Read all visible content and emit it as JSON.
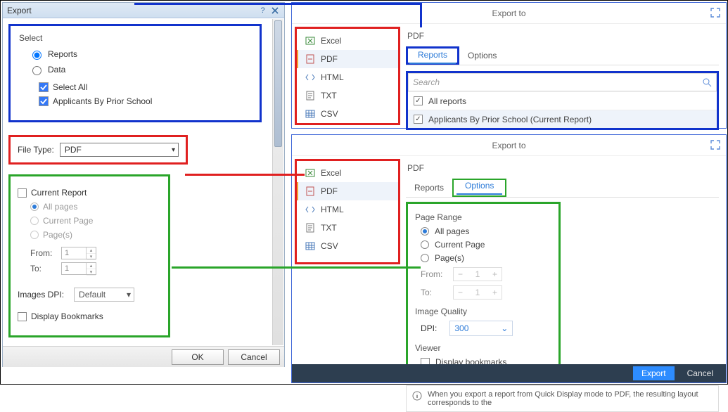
{
  "legacy": {
    "title": "Export",
    "select_label": "Select",
    "radios": {
      "reports": "Reports",
      "data": "Data",
      "selected": "reports"
    },
    "check_all": "Select All",
    "check_item": "Applicants By Prior School",
    "file_type_label": "File Type:",
    "file_type_value": "PDF",
    "opt": {
      "current_report": "Current Report",
      "all_pages": "All pages",
      "current_page": "Current Page",
      "pages": "Page(s)",
      "from": "From:",
      "to": "To:",
      "from_val": "1",
      "to_val": "1",
      "images_dpi": "Images DPI:",
      "dpi_value": "Default",
      "display_bookmarks": "Display Bookmarks"
    },
    "buttons": {
      "ok": "OK",
      "cancel": "Cancel"
    }
  },
  "modern_a": {
    "title": "Export to",
    "formats": [
      "Excel",
      "PDF",
      "HTML",
      "TXT",
      "CSV"
    ],
    "selected_format": "PDF",
    "head": "PDF",
    "tabs": {
      "reports": "Reports",
      "options": "Options",
      "active": "reports"
    },
    "search_placeholder": "Search",
    "reports": {
      "all": "All reports",
      "item": "Applicants By Prior School (Current Report)"
    }
  },
  "modern_b": {
    "title": "Export to",
    "formats": [
      "Excel",
      "PDF",
      "HTML",
      "TXT",
      "CSV"
    ],
    "selected_format": "PDF",
    "head": "PDF",
    "tabs": {
      "reports": "Reports",
      "options": "Options",
      "active": "options"
    },
    "page_range": {
      "title": "Page Range",
      "all": "All pages",
      "current": "Current Page",
      "pages": "Page(s)",
      "from": "From:",
      "to": "To:",
      "from_val": "1",
      "to_val": "1"
    },
    "image_quality": {
      "title": "Image Quality",
      "dpi_label": "DPI:",
      "dpi_value": "300"
    },
    "viewer": {
      "title": "Viewer",
      "display_bookmarks": "Display bookmarks"
    },
    "info": "When you export a report from Quick Display mode to PDF, the resulting layout corresponds to the",
    "buttons": {
      "export": "Export",
      "cancel": "Cancel"
    }
  }
}
